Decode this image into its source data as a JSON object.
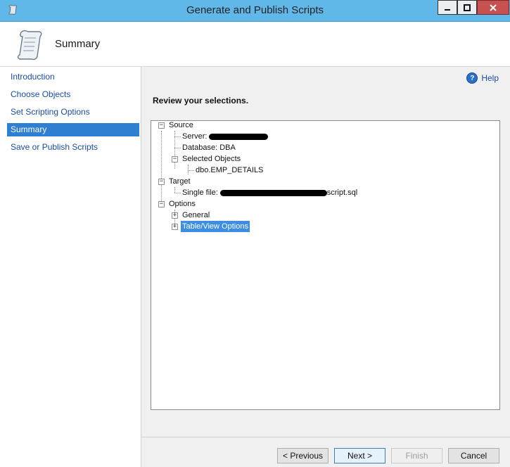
{
  "window": {
    "title": "Generate and Publish Scripts",
    "min_label": "—",
    "max_label": "☐",
    "close_label": "✕"
  },
  "header": {
    "title": "Summary"
  },
  "nav": {
    "items": [
      {
        "label": "Introduction",
        "active": false
      },
      {
        "label": "Choose Objects",
        "active": false
      },
      {
        "label": "Set Scripting Options",
        "active": false
      },
      {
        "label": "Summary",
        "active": true
      },
      {
        "label": "Save or Publish Scripts",
        "active": false
      }
    ]
  },
  "help": {
    "label": "Help",
    "icon": "help-icon"
  },
  "main": {
    "review_heading": "Review your selections."
  },
  "tree": {
    "source": "Source",
    "server": "Server:",
    "database": "Database: DBA",
    "selected_objects": "Selected Objects",
    "emp_details": "dbo.EMP_DETAILS",
    "target": "Target",
    "single_file": "Single file:",
    "script_suffix": "script.sql",
    "options": "Options",
    "general": "General",
    "table_view_options": "Table/View Options"
  },
  "buttons": {
    "previous": "< Previous",
    "next": "Next >",
    "finish": "Finish",
    "cancel": "Cancel"
  },
  "colors": {
    "titlebar": "#60b8e8",
    "nav_active": "#2e7fd1",
    "link": "#1a4ca8"
  }
}
